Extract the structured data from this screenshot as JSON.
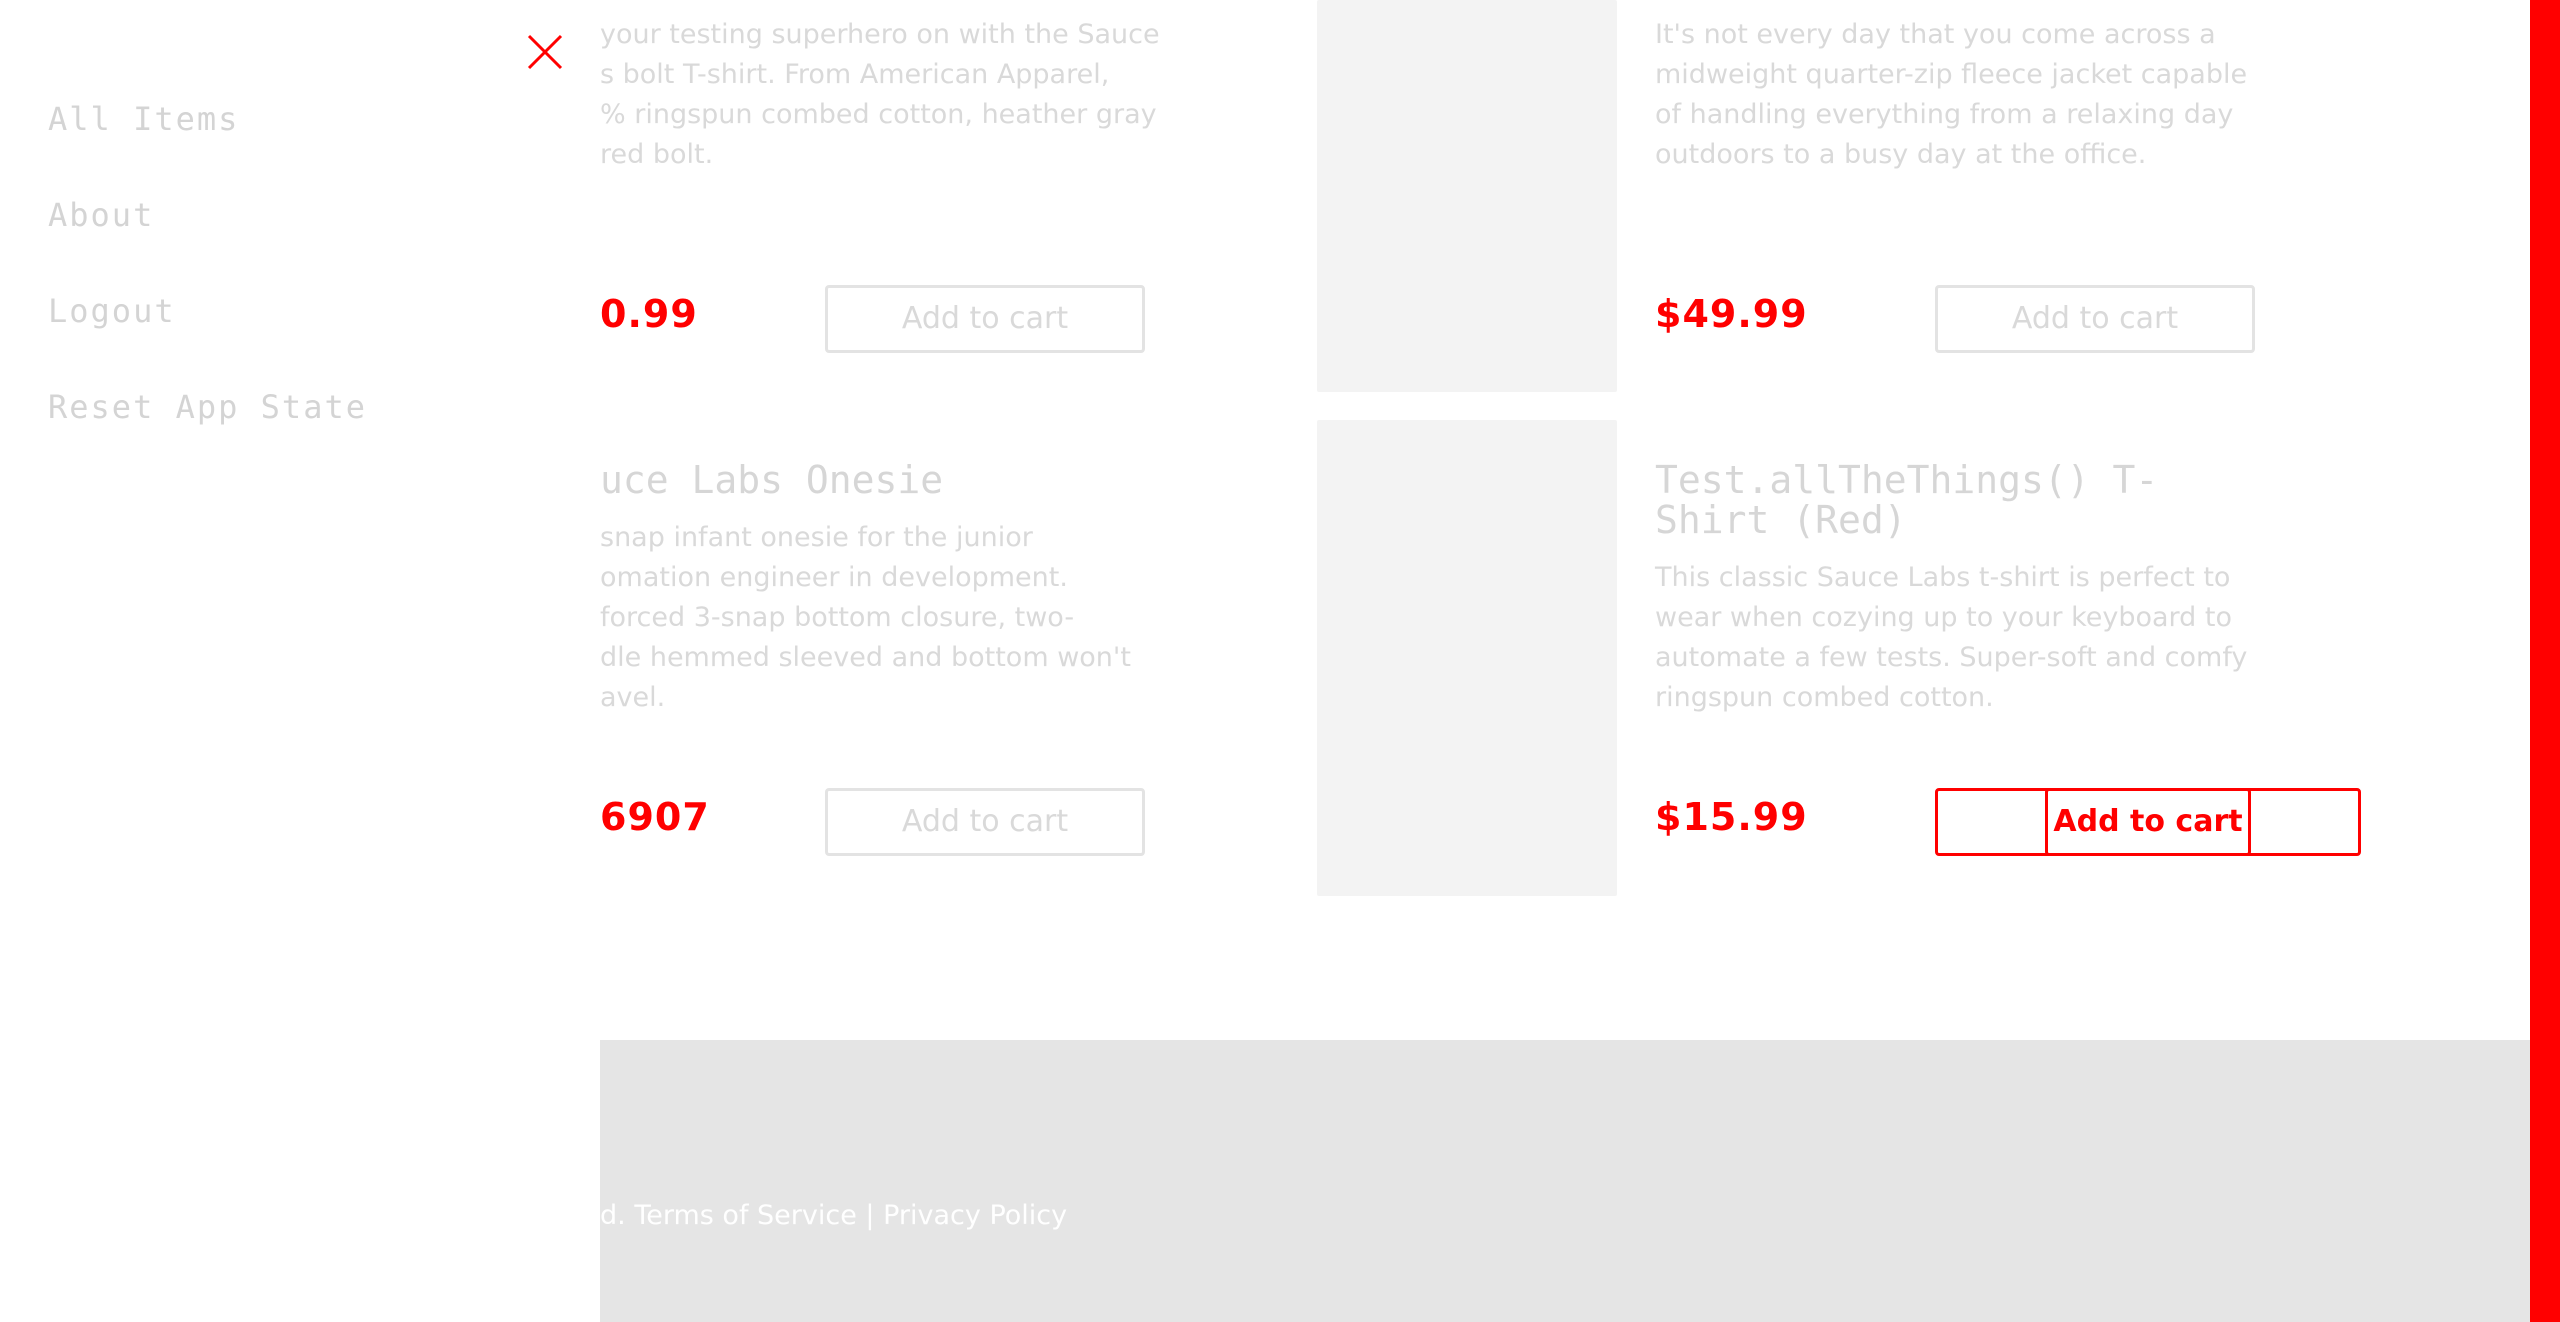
{
  "sidebar": {
    "items": [
      {
        "label": "All Items"
      },
      {
        "label": "About"
      },
      {
        "label": "Logout"
      },
      {
        "label": "Reset App State"
      }
    ]
  },
  "products": [
    {
      "desc_lines": [
        "your testing superhero on with the Sauce",
        "s bolt T-shirt. From American Apparel,",
        "% ringspun combed cotton, heather gray",
        " red bolt."
      ],
      "price": "0.99",
      "button": "Add to cart"
    },
    {
      "desc_lines": [
        "It's not every day that you come across a",
        "midweight quarter-zip fleece jacket capable",
        "of handling everything from a relaxing day",
        "outdoors to a busy day at the office."
      ],
      "price": "$49.99",
      "button": "Add to cart"
    },
    {
      "title": "uce Labs Onesie",
      "desc_lines": [
        "snap infant onesie for the junior",
        "omation engineer in development.",
        "forced 3-snap bottom closure, two-",
        "dle hemmed sleeved and bottom won't",
        "avel."
      ],
      "price": "6907",
      "button": "Add to cart"
    },
    {
      "title_lines": [
        "Test.allTheThings() T-",
        "Shirt (Red)"
      ],
      "desc_lines": [
        "This classic Sauce Labs t-shirt is perfect to",
        "wear when cozying up to your keyboard to",
        "automate a few tests. Super-soft and comfy",
        "ringspun combed cotton."
      ],
      "price": "$15.99",
      "button": "Add to cart"
    }
  ],
  "footer": {
    "text_prefix": "d.",
    "terms": "Terms of Service",
    "separator": "|",
    "privacy": "Privacy Policy"
  },
  "colors": {
    "accent": "#ff0000",
    "footer_bg": "#e5e5e5"
  }
}
